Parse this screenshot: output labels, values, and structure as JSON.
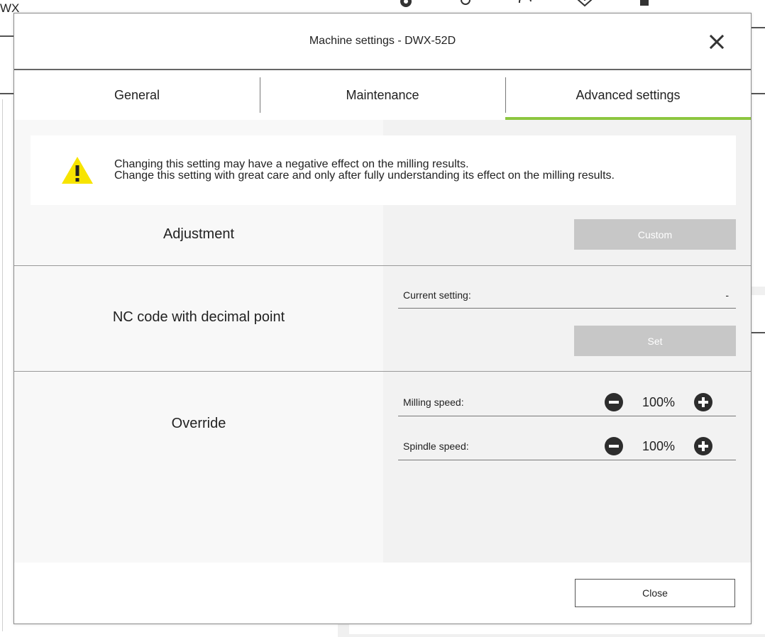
{
  "background": {
    "app_title": "WX",
    "top_icons": [
      "gear-icon",
      "user-icon",
      "sync-icon",
      "heart-icon",
      "bell-icon"
    ]
  },
  "modal": {
    "title": "Machine settings - DWX-52D",
    "close_icon": "close-icon",
    "tabs": [
      {
        "label": "General",
        "active": false
      },
      {
        "label": "Maintenance",
        "active": false
      },
      {
        "label": "Advanced settings",
        "active": true
      }
    ],
    "accent_color": "#8cc63f",
    "warning": {
      "icon": "warning-icon",
      "line1": "Changing this setting may have a negative effect on the milling results.",
      "line2": "Change this setting with great care and only after fully understanding its effect on the milling results."
    },
    "adjustment": {
      "label": "Adjustment",
      "button": "Custom"
    },
    "nc_code": {
      "label": "NC code with decimal point",
      "current_setting_label": "Current setting:",
      "current_setting_value": "-",
      "button": "Set"
    },
    "override": {
      "label": "Override",
      "milling_speed_label": "Milling speed:",
      "milling_speed_value": "100%",
      "spindle_speed_label": "Spindle speed:",
      "spindle_speed_value": "100%"
    },
    "close_button": "Close"
  }
}
